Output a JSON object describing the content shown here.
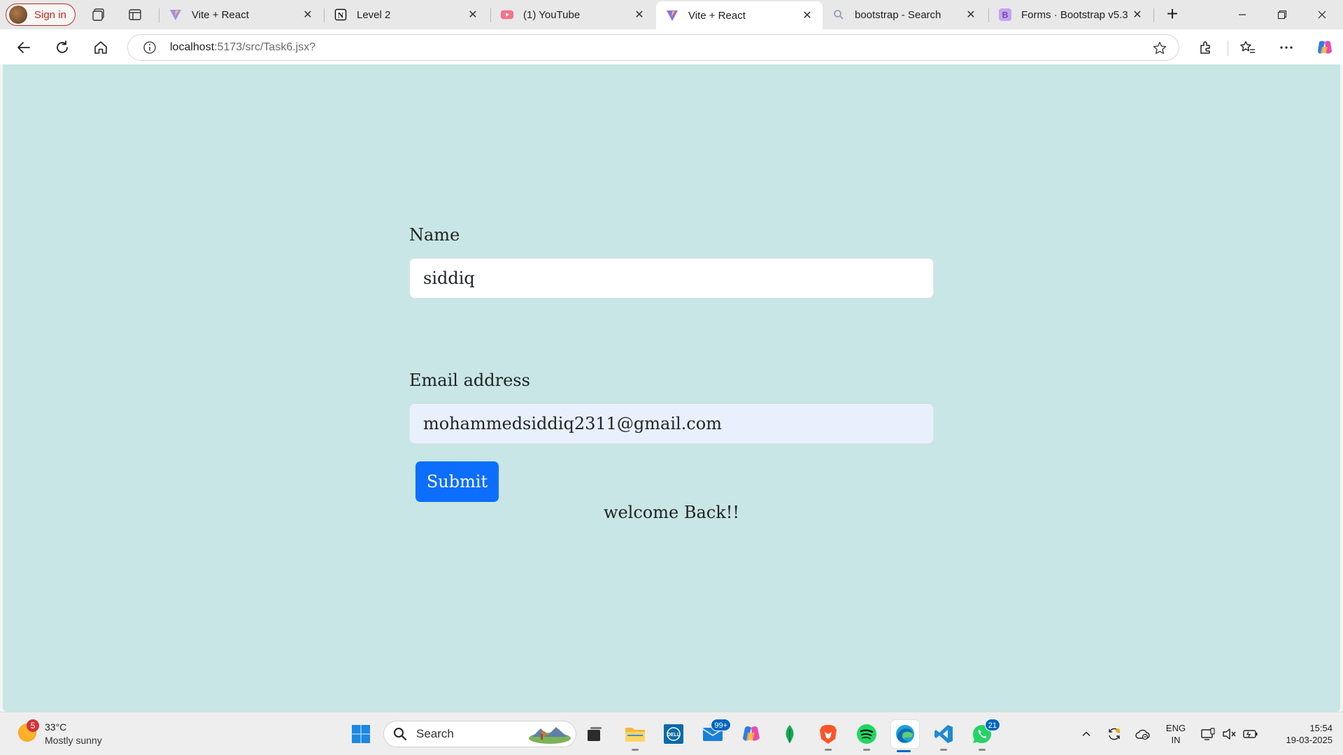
{
  "browser": {
    "profile_label": "Sign in",
    "tabs": [
      {
        "label": "Vite + React",
        "icon": "vite-icon"
      },
      {
        "label": "Level 2",
        "icon": "notion-icon"
      },
      {
        "label": "(1) YouTube",
        "icon": "youtube-icon"
      },
      {
        "label": "Vite + React",
        "icon": "vite-icon",
        "active": true
      },
      {
        "label": "bootstrap - Search",
        "icon": "search-icon"
      },
      {
        "label": "Forms · Bootstrap v5.3",
        "icon": "bootstrap-icon"
      }
    ],
    "url_host": "localhost",
    "url_rest": ":5173/src/Task6.jsx?"
  },
  "form": {
    "name_label": "Name",
    "name_value": "siddiq",
    "email_label": "Email address",
    "email_value": "mohammedsiddiq2311@gmail.com",
    "submit_label": "Submit",
    "welcome_text": "welcome Back!!"
  },
  "taskbar": {
    "weather_alert": "5",
    "weather_temp": "33°C",
    "weather_condition": "Mostly sunny",
    "search_label": "Search",
    "mail_badge": "99+",
    "whatsapp_badge": "21",
    "language_1": "ENG",
    "language_2": "IN",
    "time": "15:54",
    "date": "19-03-2025"
  },
  "colors": {
    "page_background": "#c8e6e5",
    "submit_button": "#0d6efd",
    "email_autofill": "#e8f0fe",
    "profile_accent": "#c42b1c"
  }
}
